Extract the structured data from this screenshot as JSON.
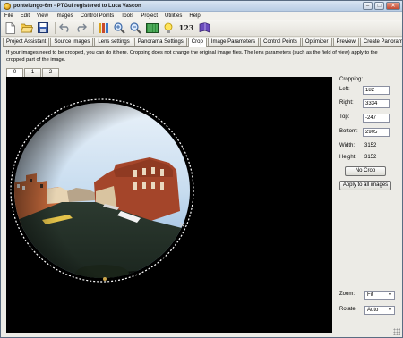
{
  "window": {
    "title": "pontelungo-6m - PTGui registered to Luca Vascon"
  },
  "menu": [
    "File",
    "Edit",
    "View",
    "Images",
    "Control Points",
    "Tools",
    "Project",
    "Utilities",
    "Help"
  ],
  "toolbar": {
    "icons": [
      "new-file-icon",
      "open-folder-icon",
      "save-icon",
      "undo-icon",
      "redo-icon",
      "tools-icon",
      "zoom-in-icon",
      "zoom-out-icon",
      "panorama-editor-icon",
      "tips-icon",
      "numbers-icon",
      "help-book-icon"
    ],
    "numbers_label": "123"
  },
  "tabs": [
    {
      "label": "Project Assistant",
      "active": false
    },
    {
      "label": "Source images",
      "active": false
    },
    {
      "label": "Lens settings",
      "active": false
    },
    {
      "label": "Panorama Settings",
      "active": false
    },
    {
      "label": "Crop",
      "active": true
    },
    {
      "label": "Image Parameters",
      "active": false
    },
    {
      "label": "Control Points",
      "active": false
    },
    {
      "label": "Optimizer",
      "active": false
    },
    {
      "label": "Preview",
      "active": false
    },
    {
      "label": "Create Panorama",
      "active": false
    }
  ],
  "info_text": "If your images need to be cropped, you can do it here. Cropping does not change the original image files. The lens parameters (such as the field of view) apply to the cropped part of the image.",
  "image_tabs": [
    "0",
    "1",
    "2"
  ],
  "cropping": {
    "title": "Cropping:",
    "left_label": "Left:",
    "left": "182",
    "right_label": "Right:",
    "right": "3334",
    "top_label": "Top:",
    "top": "-247",
    "bottom_label": "Bottom:",
    "bottom": "2905",
    "width_label": "Width:",
    "width": "3152",
    "height_label": "Height:",
    "height": "3152",
    "no_crop": "No Crop",
    "apply_all": "Apply to all images"
  },
  "view": {
    "zoom_label": "Zoom:",
    "zoom": "Fit",
    "rotate_label": "Rotate:",
    "rotate": "Auto"
  }
}
